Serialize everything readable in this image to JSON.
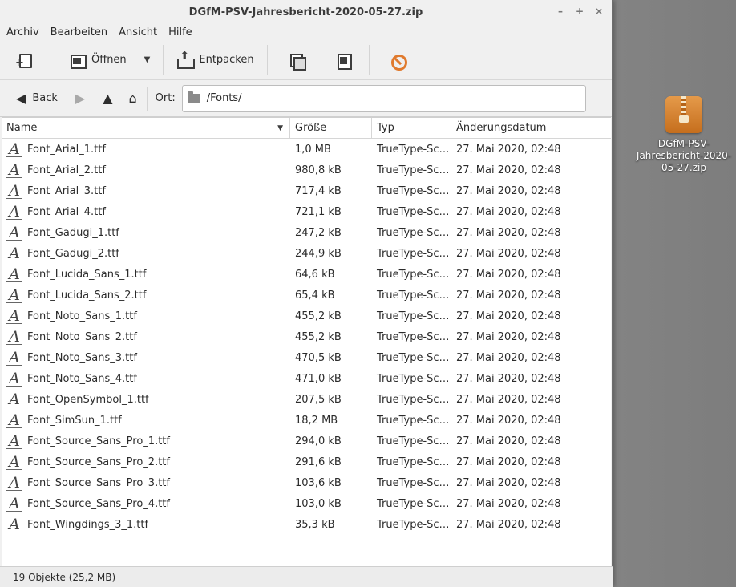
{
  "window": {
    "title": "DGfM-PSV-Jahresbericht-2020-05-27.zip",
    "controls": [
      "–",
      "+",
      "×"
    ]
  },
  "menu": [
    "Archiv",
    "Bearbeiten",
    "Ansicht",
    "Hilfe"
  ],
  "toolbar": {
    "open_label": "Öffnen",
    "extract_label": "Entpacken"
  },
  "location": {
    "back_label": "Back",
    "ort_label": "Ort:",
    "path": "/Fonts/"
  },
  "columns": {
    "name": "Name",
    "size": "Größe",
    "type": "Typ",
    "date": "Änderungsdatum"
  },
  "files": [
    {
      "name": "Font_Arial_1.ttf",
      "size": "1,0 MB",
      "type": "TrueType-Sc…",
      "date": "27. Mai 2020, 02:48"
    },
    {
      "name": "Font_Arial_2.ttf",
      "size": "980,8 kB",
      "type": "TrueType-Sc…",
      "date": "27. Mai 2020, 02:48"
    },
    {
      "name": "Font_Arial_3.ttf",
      "size": "717,4 kB",
      "type": "TrueType-Sc…",
      "date": "27. Mai 2020, 02:48"
    },
    {
      "name": "Font_Arial_4.ttf",
      "size": "721,1 kB",
      "type": "TrueType-Sc…",
      "date": "27. Mai 2020, 02:48"
    },
    {
      "name": "Font_Gadugi_1.ttf",
      "size": "247,2 kB",
      "type": "TrueType-Sc…",
      "date": "27. Mai 2020, 02:48"
    },
    {
      "name": "Font_Gadugi_2.ttf",
      "size": "244,9 kB",
      "type": "TrueType-Sc…",
      "date": "27. Mai 2020, 02:48"
    },
    {
      "name": "Font_Lucida_Sans_1.ttf",
      "size": "64,6 kB",
      "type": "TrueType-Sc…",
      "date": "27. Mai 2020, 02:48"
    },
    {
      "name": "Font_Lucida_Sans_2.ttf",
      "size": "65,4 kB",
      "type": "TrueType-Sc…",
      "date": "27. Mai 2020, 02:48"
    },
    {
      "name": "Font_Noto_Sans_1.ttf",
      "size": "455,2 kB",
      "type": "TrueType-Sc…",
      "date": "27. Mai 2020, 02:48"
    },
    {
      "name": "Font_Noto_Sans_2.ttf",
      "size": "455,2 kB",
      "type": "TrueType-Sc…",
      "date": "27. Mai 2020, 02:48"
    },
    {
      "name": "Font_Noto_Sans_3.ttf",
      "size": "470,5 kB",
      "type": "TrueType-Sc…",
      "date": "27. Mai 2020, 02:48"
    },
    {
      "name": "Font_Noto_Sans_4.ttf",
      "size": "471,0 kB",
      "type": "TrueType-Sc…",
      "date": "27. Mai 2020, 02:48"
    },
    {
      "name": "Font_OpenSymbol_1.ttf",
      "size": "207,5 kB",
      "type": "TrueType-Sc…",
      "date": "27. Mai 2020, 02:48"
    },
    {
      "name": "Font_SimSun_1.ttf",
      "size": "18,2 MB",
      "type": "TrueType-Sc…",
      "date": "27. Mai 2020, 02:48"
    },
    {
      "name": "Font_Source_Sans_Pro_1.ttf",
      "size": "294,0 kB",
      "type": "TrueType-Sc…",
      "date": "27. Mai 2020, 02:48"
    },
    {
      "name": "Font_Source_Sans_Pro_2.ttf",
      "size": "291,6 kB",
      "type": "TrueType-Sc…",
      "date": "27. Mai 2020, 02:48"
    },
    {
      "name": "Font_Source_Sans_Pro_3.ttf",
      "size": "103,6 kB",
      "type": "TrueType-Sc…",
      "date": "27. Mai 2020, 02:48"
    },
    {
      "name": "Font_Source_Sans_Pro_4.ttf",
      "size": "103,0 kB",
      "type": "TrueType-Sc…",
      "date": "27. Mai 2020, 02:48"
    },
    {
      "name": "Font_Wingdings_3_1.ttf",
      "size": "35,3 kB",
      "type": "TrueType-Sc…",
      "date": "27. Mai 2020, 02:48"
    }
  ],
  "file_icon_glyph": "A",
  "status": "19 Objekte (25,2 MB)",
  "desktop": {
    "icon_label": "DGfM-PSV-Jahresbericht-2020-05-27.zip"
  }
}
